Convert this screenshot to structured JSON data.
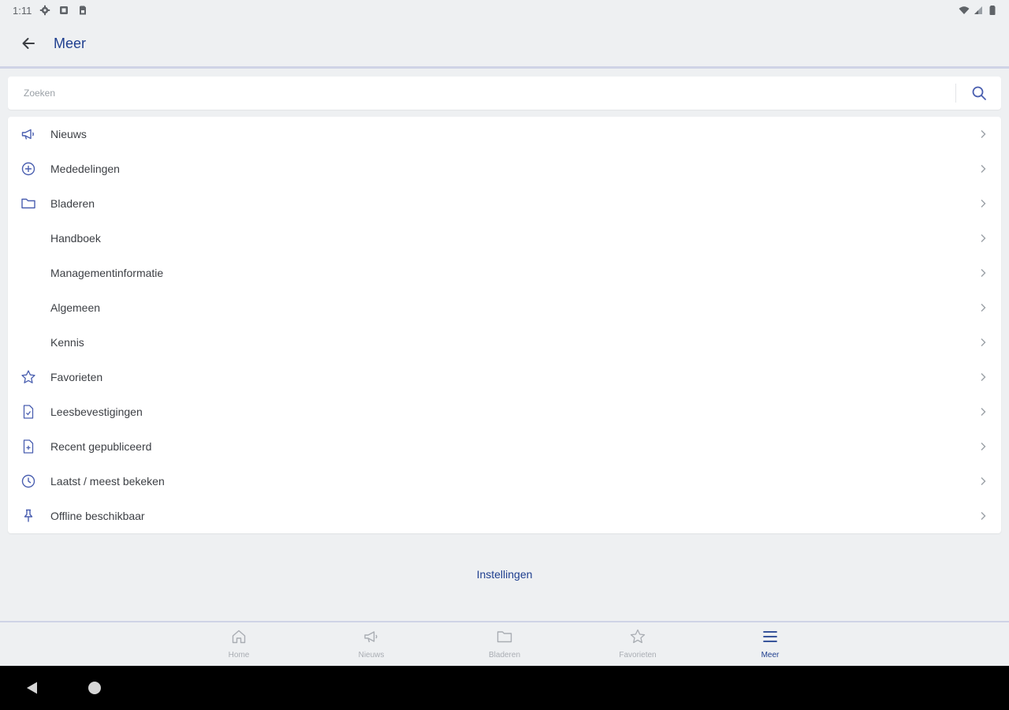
{
  "status_bar": {
    "time": "1:11"
  },
  "app_bar": {
    "title": "Meer",
    "back_icon": "arrow-left-icon"
  },
  "search": {
    "placeholder": "Zoeken",
    "value": "",
    "icon": "search-icon"
  },
  "menu": {
    "items": [
      {
        "label": "Nieuws",
        "icon": "megaphone-icon"
      },
      {
        "label": "Mededelingen",
        "icon": "plus-circle-icon"
      },
      {
        "label": "Bladeren",
        "icon": "folder-icon"
      },
      {
        "label": "Handboek",
        "icon": ""
      },
      {
        "label": "Managementinformatie",
        "icon": ""
      },
      {
        "label": "Algemeen",
        "icon": ""
      },
      {
        "label": "Kennis",
        "icon": ""
      },
      {
        "label": "Favorieten",
        "icon": "star-icon"
      },
      {
        "label": "Leesbevestigingen",
        "icon": "document-check-icon"
      },
      {
        "label": "Recent gepubliceerd",
        "icon": "document-plus-icon"
      },
      {
        "label": "Laatst / meest bekeken",
        "icon": "clock-icon"
      },
      {
        "label": "Offline beschikbaar",
        "icon": "pin-icon"
      }
    ]
  },
  "settings_link": "Instellingen",
  "bottom_nav": {
    "items": [
      {
        "label": "Home",
        "icon": "home-icon",
        "active": false
      },
      {
        "label": "Nieuws",
        "icon": "megaphone-icon",
        "active": false
      },
      {
        "label": "Bladeren",
        "icon": "folder-icon",
        "active": false
      },
      {
        "label": "Favorieten",
        "icon": "star-icon",
        "active": false
      },
      {
        "label": "Meer",
        "icon": "menu-icon",
        "active": true
      }
    ]
  },
  "colors": {
    "accent": "#1f3f8f",
    "icon": "#4a5fb0",
    "inactive": "#a9adb3",
    "background": "#eef0f2"
  }
}
